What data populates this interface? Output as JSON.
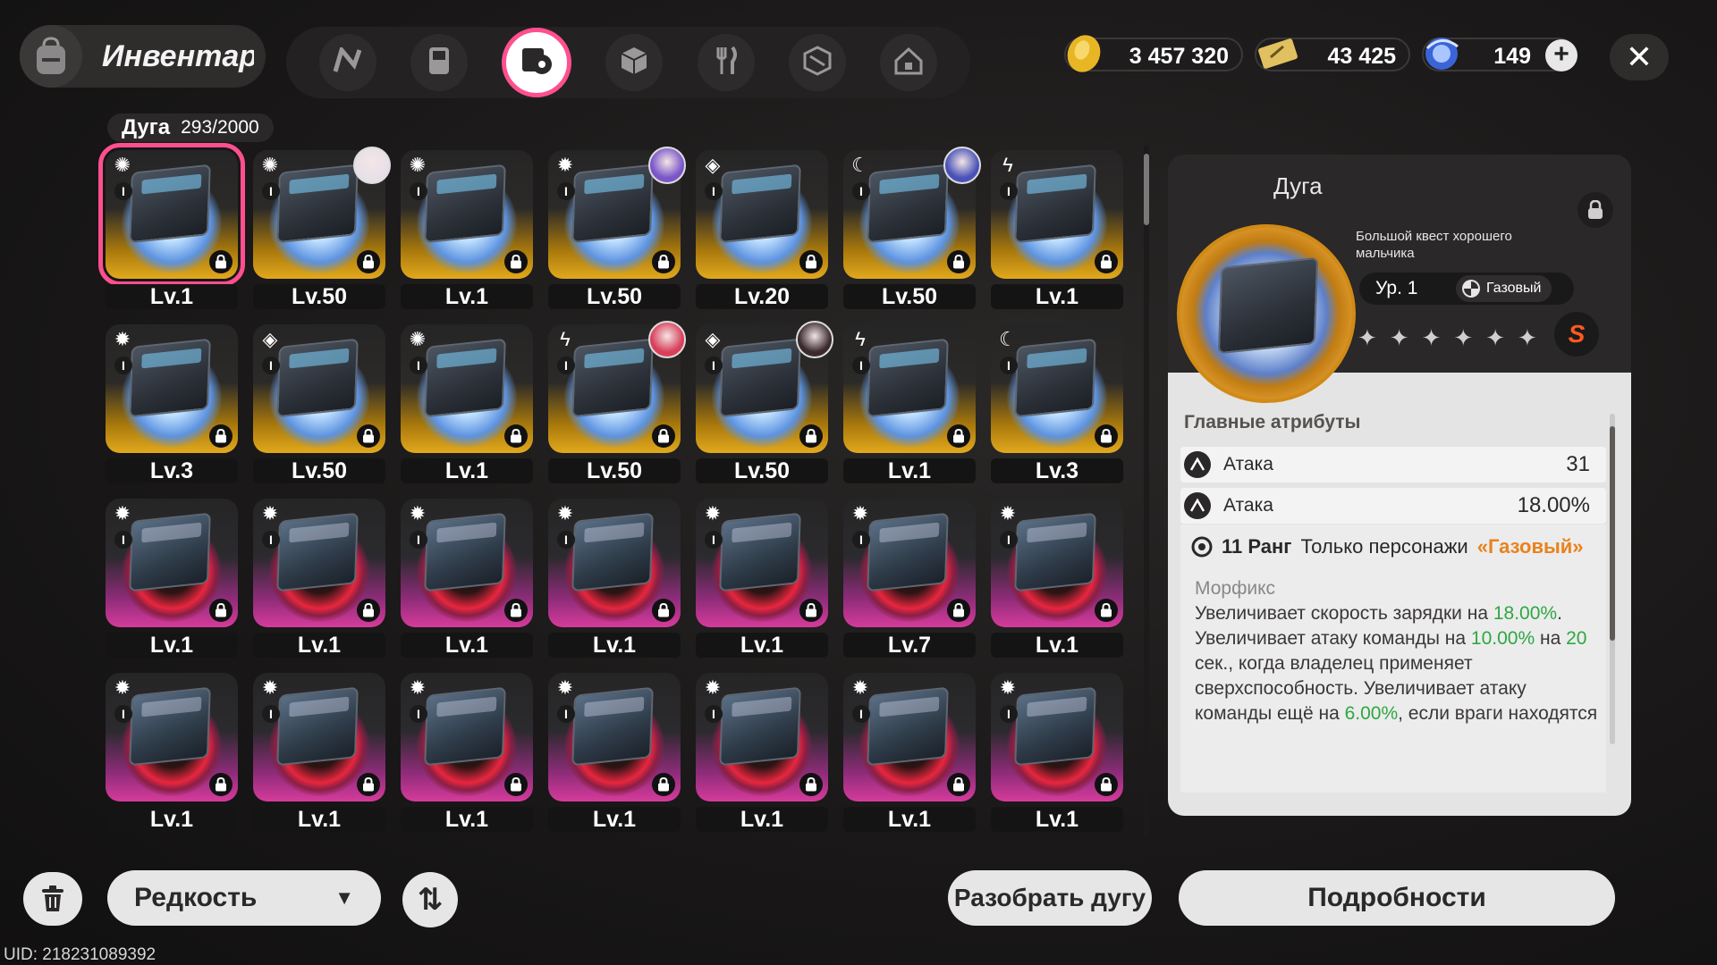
{
  "header": {
    "title": "Инвентарь",
    "tabs": [
      {
        "icon": "n-logo-icon"
      },
      {
        "icon": "gameboy-icon"
      },
      {
        "icon": "arc-disc-icon",
        "active": true
      },
      {
        "icon": "cube-icon"
      },
      {
        "icon": "fork-knife-icon"
      },
      {
        "icon": "hex-box-icon"
      },
      {
        "icon": "house-icon"
      }
    ],
    "currencies": [
      {
        "icon": "gold-coin-icon",
        "value": "3 457 320"
      },
      {
        "icon": "ticket-icon",
        "value": "43 425"
      },
      {
        "icon": "blue-orb-icon",
        "value": "149"
      }
    ],
    "plus_label": "+",
    "close_label": "✕"
  },
  "inventory": {
    "label": "Дуга",
    "count": "293/2000",
    "items": [
      {
        "level": "Lv.1",
        "rarity": "gold",
        "type": "gas",
        "selected": true,
        "avatar": false
      },
      {
        "level": "Lv.50",
        "rarity": "gold",
        "type": "gas",
        "avatar": true,
        "avatar_color": "#e8e0e8"
      },
      {
        "level": "Lv.1",
        "rarity": "gold",
        "type": "gas",
        "avatar": false
      },
      {
        "level": "Lv.50",
        "rarity": "gold",
        "type": "gear",
        "avatar": true,
        "avatar_color": "#7a56c8"
      },
      {
        "level": "Lv.20",
        "rarity": "gold",
        "type": "cube",
        "avatar": false
      },
      {
        "level": "Lv.50",
        "rarity": "gold",
        "type": "moon",
        "avatar": true,
        "avatar_color": "#4a52b8"
      },
      {
        "level": "Lv.1",
        "rarity": "gold",
        "type": "bolt",
        "avatar": false
      },
      {
        "level": "Lv.3",
        "rarity": "gold",
        "type": "gear",
        "avatar": false
      },
      {
        "level": "Lv.50",
        "rarity": "gold",
        "type": "cube",
        "avatar": false
      },
      {
        "level": "Lv.1",
        "rarity": "gold",
        "type": "gas",
        "avatar": false
      },
      {
        "level": "Lv.50",
        "rarity": "gold",
        "type": "bolt",
        "avatar": true,
        "avatar_color": "#d8405a"
      },
      {
        "level": "Lv.50",
        "rarity": "gold",
        "type": "cube",
        "avatar": true,
        "avatar_color": "#3a2a2e"
      },
      {
        "level": "Lv.1",
        "rarity": "gold",
        "type": "bolt",
        "avatar": false
      },
      {
        "level": "Lv.3",
        "rarity": "gold",
        "type": "moon",
        "avatar": false
      },
      {
        "level": "Lv.1",
        "rarity": "purple",
        "type": "gear",
        "avatar": false
      },
      {
        "level": "Lv.1",
        "rarity": "purple",
        "type": "gear",
        "avatar": false
      },
      {
        "level": "Lv.1",
        "rarity": "purple",
        "type": "gear",
        "avatar": false
      },
      {
        "level": "Lv.1",
        "rarity": "purple",
        "type": "gear",
        "avatar": false
      },
      {
        "level": "Lv.1",
        "rarity": "purple",
        "type": "gear",
        "avatar": false
      },
      {
        "level": "Lv.7",
        "rarity": "purple",
        "type": "gear",
        "avatar": false
      },
      {
        "level": "Lv.1",
        "rarity": "purple",
        "type": "gear",
        "avatar": false
      },
      {
        "level": "Lv.1",
        "rarity": "purple",
        "type": "gear",
        "avatar": false
      },
      {
        "level": "Lv.1",
        "rarity": "purple",
        "type": "gear",
        "avatar": false
      },
      {
        "level": "Lv.1",
        "rarity": "purple",
        "type": "gear",
        "avatar": false
      },
      {
        "level": "Lv.1",
        "rarity": "purple",
        "type": "gear",
        "avatar": false
      },
      {
        "level": "Lv.1",
        "rarity": "purple",
        "type": "gear",
        "avatar": false
      },
      {
        "level": "Lv.1",
        "rarity": "purple",
        "type": "gear",
        "avatar": false
      },
      {
        "level": "Lv.1",
        "rarity": "purple",
        "type": "gear",
        "avatar": false
      }
    ],
    "roman": "I"
  },
  "detail": {
    "name": "Дуга",
    "subtitle": "Большой квест хорошего мальчика",
    "level": "Ур. 1",
    "element": "Газовый",
    "stars": 6,
    "badge": "S",
    "attributes_title": "Главные атрибуты",
    "attributes": [
      {
        "name": "Атака",
        "value": "31"
      },
      {
        "name": "Атака",
        "value": "18.00%"
      }
    ],
    "skill": {
      "rank": "11 Ранг",
      "restriction": "Только персонажи",
      "restriction_highlight": "«Газовый»",
      "name": "Морфикс",
      "parts": [
        {
          "t": "Увеличивает скорость зарядки на "
        },
        {
          "t": "18.00%",
          "g": true
        },
        {
          "t": ". Увеличивает атаку команды на "
        },
        {
          "t": "10.00%",
          "g": true
        },
        {
          "t": " на "
        },
        {
          "t": "20",
          "g": true
        },
        {
          "t": " сек., когда владелец применяет сверхспособность. Увеличивает атаку команды ещё на "
        },
        {
          "t": "6.00%",
          "g": true
        },
        {
          "t": ", если враги находятся под контролем эффекта"
        }
      ]
    }
  },
  "bottom": {
    "rarity_label": "Редкость",
    "sort_label": "⇅",
    "dismantle_label": "Разобрать дугу",
    "details_label": "Подробности",
    "uid": "UID: 218231089392"
  },
  "colors": {
    "accent_pink": "#ff4f8f",
    "gold": "#e2a91d",
    "purple": "#d63b9c",
    "green_value": "#2ea743",
    "orange_element": "#e8821c"
  }
}
